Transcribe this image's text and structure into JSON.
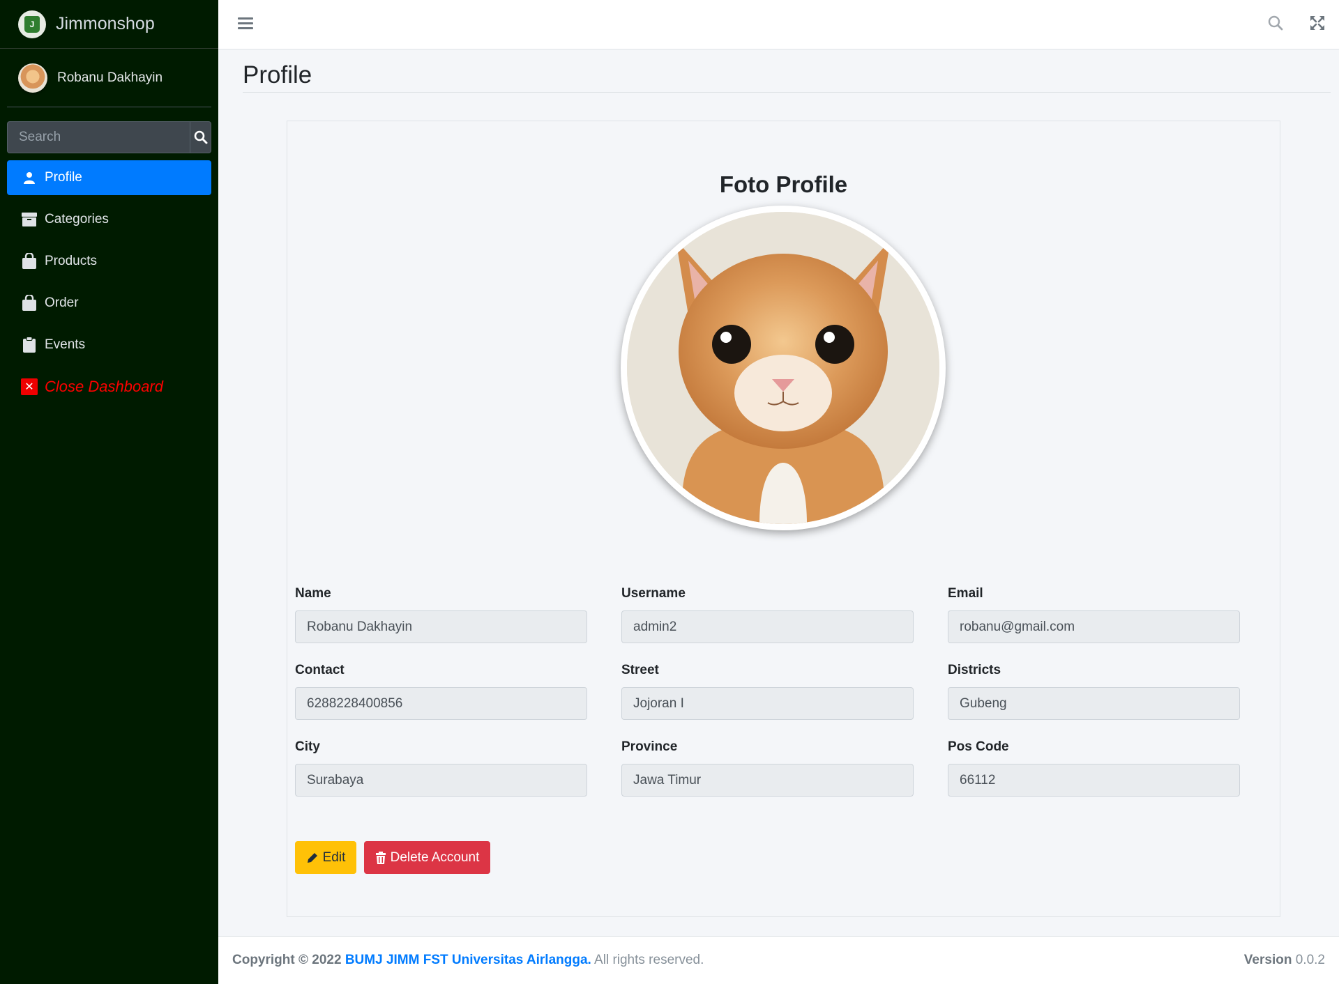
{
  "brand": {
    "name": "Jimmonshop",
    "logo_text": "J"
  },
  "user": {
    "name": "Robanu Dakhayin"
  },
  "sidebar": {
    "search_placeholder": "Search",
    "items": [
      {
        "label": "Profile",
        "icon": "user-icon",
        "active": true
      },
      {
        "label": "Categories",
        "icon": "box-icon"
      },
      {
        "label": "Products",
        "icon": "shopping-bag-icon"
      },
      {
        "label": "Order",
        "icon": "shopping-bag-icon"
      },
      {
        "label": "Events",
        "icon": "clipboard-icon"
      }
    ],
    "close_label": "Close Dashboard"
  },
  "page": {
    "title": "Profile"
  },
  "profile": {
    "photo_title": "Foto Profile",
    "fields": {
      "name": {
        "label": "Name",
        "value": "Robanu Dakhayin"
      },
      "username": {
        "label": "Username",
        "value": "admin2"
      },
      "email": {
        "label": "Email",
        "value": "robanu@gmail.com"
      },
      "contact": {
        "label": "Contact",
        "value": "6288228400856"
      },
      "street": {
        "label": "Street",
        "value": "Jojoran I"
      },
      "districts": {
        "label": "Districts",
        "value": "Gubeng"
      },
      "city": {
        "label": "City",
        "value": "Surabaya"
      },
      "province": {
        "label": "Province",
        "value": "Jawa Timur"
      },
      "poscode": {
        "label": "Pos Code",
        "value": "66112"
      }
    },
    "edit_label": "Edit",
    "delete_label": "Delete Account"
  },
  "footer": {
    "copyright": "Copyright © 2022",
    "org": "BUMJ JIMM FST Universitas Airlangga.",
    "rights": "All rights reserved.",
    "version_label": "Version",
    "version": "0.0.2"
  },
  "colors": {
    "sidebar_bg": "#001b00",
    "active": "#007bff",
    "edit": "#ffc107",
    "delete": "#dc3545",
    "close": "#ff0000"
  }
}
